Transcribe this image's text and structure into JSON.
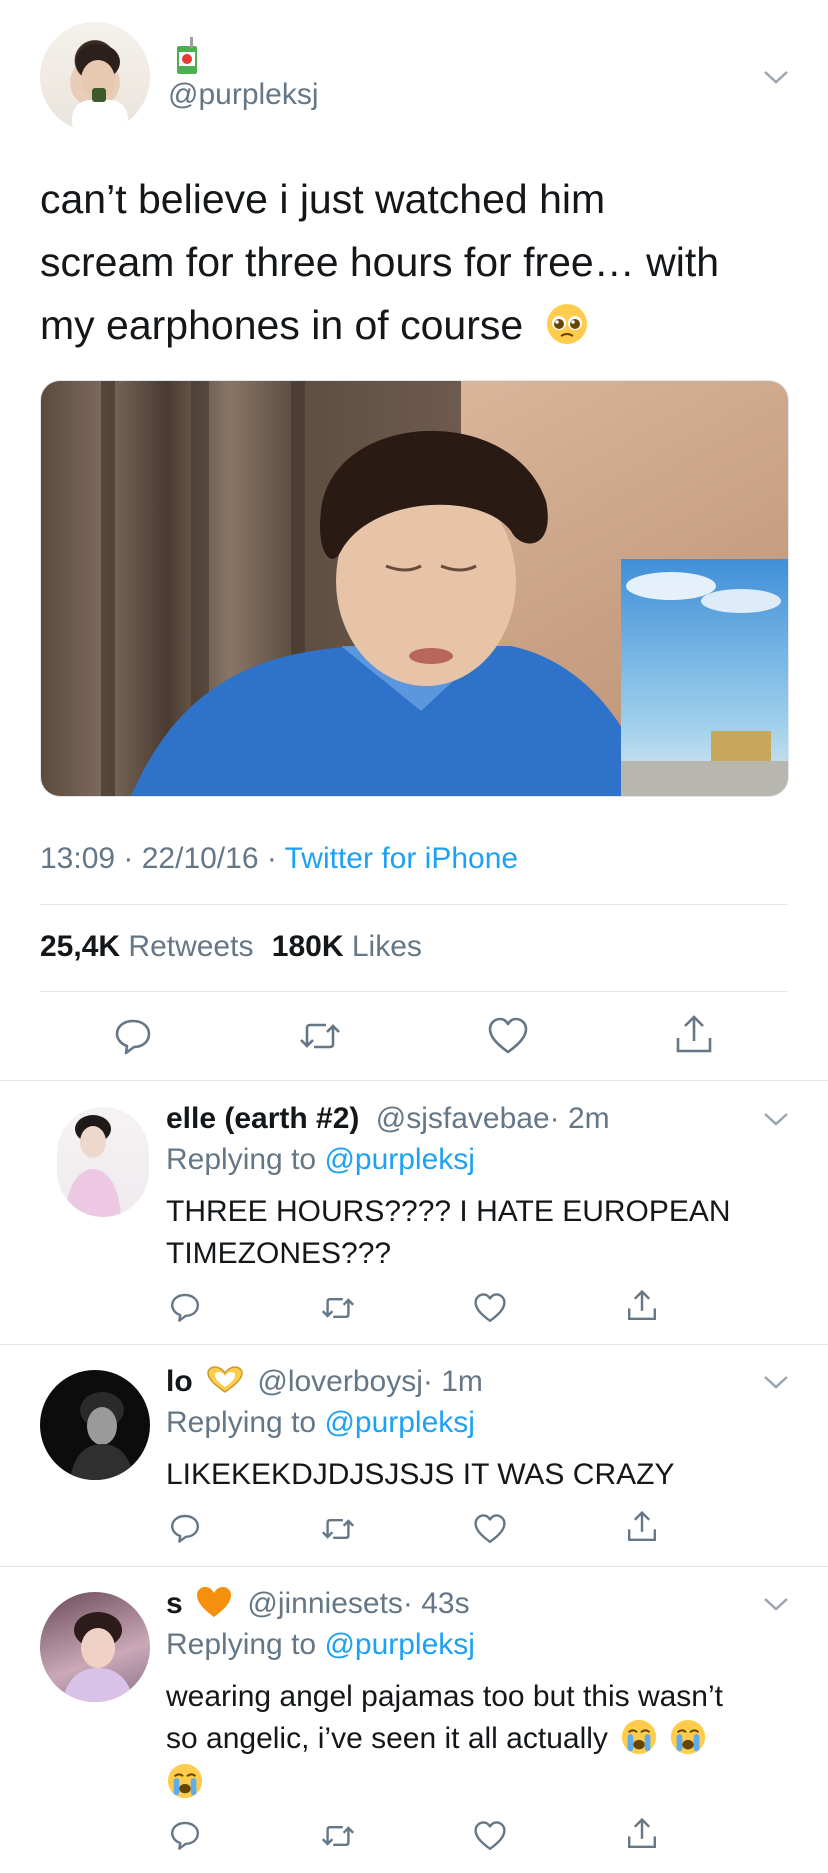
{
  "main_tweet": {
    "name_emoji": "🧃",
    "handle": "@purpleksj",
    "text_line1": "can’t believe i just watched him",
    "text_line2": "scream for three hours for free… with",
    "text_line3": "my earphones in of course",
    "time": "13:09 · 22/10/16 · ",
    "source": "Twitter for iPhone",
    "retweets_count": "25,4K",
    "retweets_label": " Retweets",
    "likes_count": "180K",
    "likes_label": " Likes"
  },
  "replies": [
    {
      "name": "elle (earth #2)",
      "handle": "@sjsfavebae",
      "time": "· 2m",
      "replying_prefix": "Replying to ",
      "replying_to": "@purpleksj",
      "text_line1": "THREE HOURS???? I HATE EUROPEAN",
      "text_line2": "TIMEZONES???"
    },
    {
      "name": "lo",
      "handle": "@loverboysj",
      "time": "· 1m",
      "replying_prefix": "Replying to ",
      "replying_to": "@purpleksj",
      "text_line1": "LIKEKEKDJDJSJSJS IT WAS CRAZY"
    },
    {
      "name": "s",
      "handle": "@jinniesets",
      "time": "· 43s",
      "replying_prefix": "Replying to ",
      "replying_to": "@purpleksj",
      "text_line1": "wearing angel pajamas too but this wasn’t",
      "text_line2": "so angelic, i’ve seen it all actually"
    }
  ],
  "colors": {
    "link": "#1da1f2",
    "muted": "#657786",
    "divider": "#e1e8ed"
  },
  "icons": [
    "chevron-down-icon",
    "reply-icon",
    "retweet-icon",
    "like-icon",
    "share-icon",
    "pleading-face-emoji",
    "crying-face-emoji",
    "heart-hands-emoji",
    "orange-heart-emoji",
    "juice-box-emoji"
  ]
}
